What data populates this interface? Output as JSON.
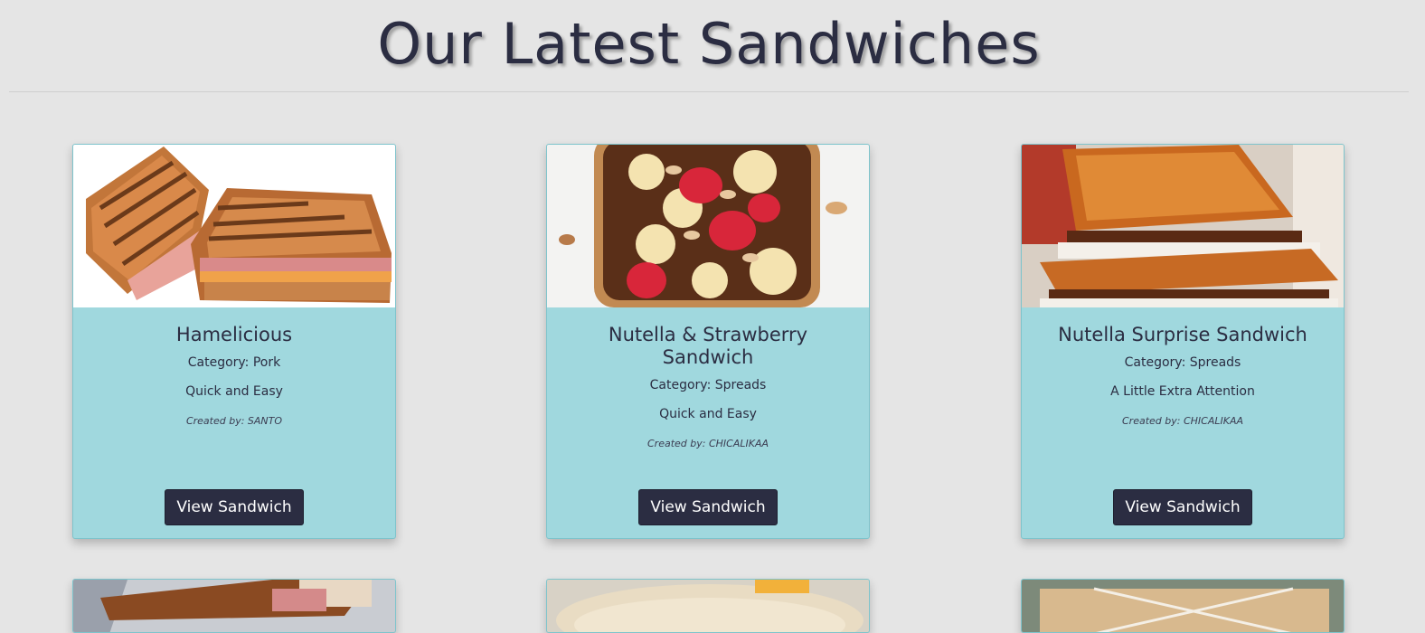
{
  "page": {
    "title": "Our Latest Sandwiches"
  },
  "sandwiches": [
    {
      "name": "Hamelicious",
      "category_line": "Category: Pork",
      "description": "Quick and Easy",
      "author_line": "Created by: SANTO",
      "button_label": "View Sandwich",
      "image": "grilled-ham-cheese-photo"
    },
    {
      "name": "Nutella & Strawberry Sandwich",
      "category_line": "Category: Spreads",
      "description": "Quick and Easy",
      "author_line": "Created by: CHICALIKAA",
      "button_label": "View Sandwich",
      "image": "nutella-banana-strawberry-toast-photo"
    },
    {
      "name": "Nutella Surprise Sandwich",
      "category_line": "Category: Spreads",
      "description": "A Little Extra Attention",
      "author_line": "Created by: CHICALIKAA",
      "button_label": "View Sandwich",
      "image": "nutella-marshmallow-toast-photo"
    }
  ],
  "more_cards_images": [
    "ham-sandwich-foil-photo",
    "pita-sandwich-photo",
    "wrapped-sandwich-twine-photo"
  ],
  "colors": {
    "background": "#e5e5e5",
    "card": "#a0d8de",
    "card_border": "#7ec4cc",
    "button": "#2b2d42",
    "text": "#2b2d42"
  }
}
